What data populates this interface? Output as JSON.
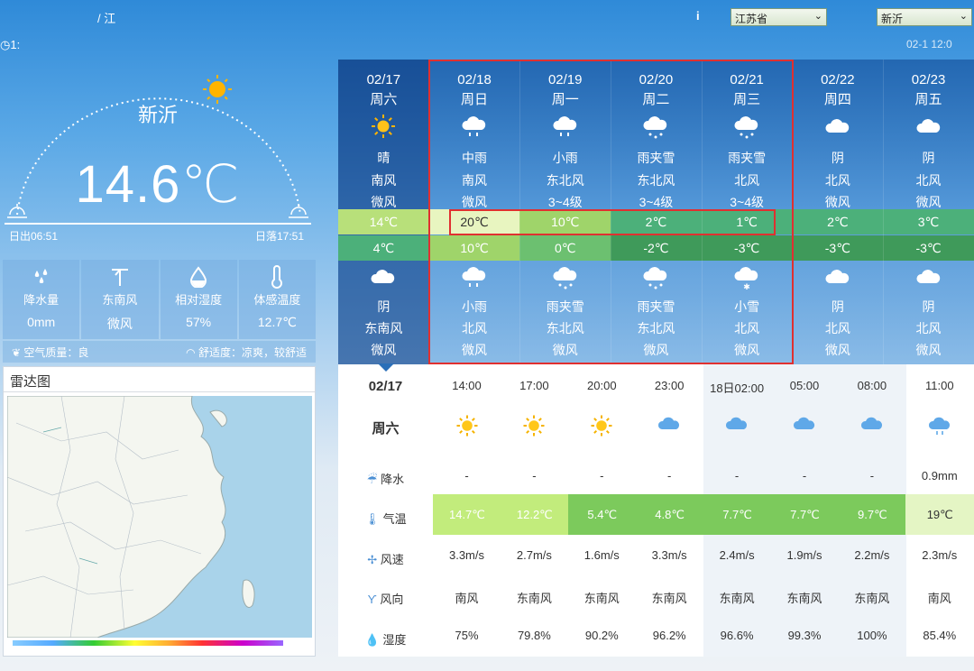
{
  "header": {
    "breadcrumb": "/ 江",
    "info_icon": "i",
    "province": "江苏省",
    "city": "新沂",
    "pub_time": "1:",
    "pub_time_right": "02-1 12:0"
  },
  "current": {
    "city": "新沂",
    "temperature": "14.6℃",
    "sunrise": "日出06:51",
    "sunset": "日落17:51"
  },
  "stats": [
    {
      "icon": "rain-drops-icon",
      "label": "降水量",
      "value": "0mm"
    },
    {
      "icon": "wind-direction-icon",
      "label": "东南风",
      "value": "微风"
    },
    {
      "icon": "humidity-drop-icon",
      "label": "相对湿度",
      "value": "57%"
    },
    {
      "icon": "thermometer-icon",
      "label": "体感温度",
      "value": "12.7℃"
    }
  ],
  "air": {
    "quality": "空气质量：良",
    "comfort": "舒适度：凉爽，较舒适"
  },
  "radar": {
    "title": "雷达图"
  },
  "forecast": [
    {
      "date": "02/17",
      "week": "周六",
      "day_icon": "sun-icon",
      "day_weather": "晴",
      "day_wind_dir": "南风",
      "day_wind_lvl": "微风",
      "hi": "14℃",
      "lo": "4℃",
      "night_icon": "cloud-icon",
      "night_weather": "阴",
      "night_wind_dir": "东南风",
      "night_wind_lvl": "微风"
    },
    {
      "date": "02/18",
      "week": "周日",
      "day_icon": "rain-icon",
      "day_weather": "中雨",
      "day_wind_dir": "南风",
      "day_wind_lvl": "微风",
      "hi": "20℃",
      "lo": "10℃",
      "night_icon": "rain-icon",
      "night_weather": "小雨",
      "night_wind_dir": "北风",
      "night_wind_lvl": "微风"
    },
    {
      "date": "02/19",
      "week": "周一",
      "day_icon": "rain-icon",
      "day_weather": "小雨",
      "day_wind_dir": "东北风",
      "day_wind_lvl": "3~4级",
      "hi": "10℃",
      "lo": "0℃",
      "night_icon": "sleet-icon",
      "night_weather": "雨夹雪",
      "night_wind_dir": "东北风",
      "night_wind_lvl": "微风"
    },
    {
      "date": "02/20",
      "week": "周二",
      "day_icon": "sleet-icon",
      "day_weather": "雨夹雪",
      "day_wind_dir": "东北风",
      "day_wind_lvl": "3~4级",
      "hi": "2℃",
      "lo": "-2℃",
      "night_icon": "sleet-icon",
      "night_weather": "雨夹雪",
      "night_wind_dir": "东北风",
      "night_wind_lvl": "微风"
    },
    {
      "date": "02/21",
      "week": "周三",
      "day_icon": "sleet-icon",
      "day_weather": "雨夹雪",
      "day_wind_dir": "北风",
      "day_wind_lvl": "3~4级",
      "hi": "1℃",
      "lo": "-3℃",
      "night_icon": "snow-icon",
      "night_weather": "小雪",
      "night_wind_dir": "北风",
      "night_wind_lvl": "微风"
    },
    {
      "date": "02/22",
      "week": "周四",
      "day_icon": "cloud-icon",
      "day_weather": "阴",
      "day_wind_dir": "北风",
      "day_wind_lvl": "微风",
      "hi": "2℃",
      "lo": "-3℃",
      "night_icon": "cloud-icon",
      "night_weather": "阴",
      "night_wind_dir": "北风",
      "night_wind_lvl": "微风"
    },
    {
      "date": "02/23",
      "week": "周五",
      "day_icon": "cloud-icon",
      "day_weather": "阴",
      "day_wind_dir": "北风",
      "day_wind_lvl": "微风",
      "hi": "3℃",
      "lo": "-3℃",
      "night_icon": "cloud-icon",
      "night_weather": "阴",
      "night_wind_dir": "北风",
      "night_wind_lvl": "微风"
    }
  ],
  "hourly": {
    "date": "02/17",
    "week": "周六",
    "row_labels": {
      "precip": "降水",
      "temp": "气温",
      "wind_speed": "风速",
      "wind_dir": "风向",
      "humidity": "湿度"
    },
    "times": [
      "14:00",
      "17:00",
      "20:00",
      "23:00",
      "18日02:00",
      "05:00",
      "08:00",
      "11:00"
    ],
    "icons": [
      "sun-icon",
      "sun-icon",
      "sun-icon",
      "cloud-icon",
      "cloud-icon",
      "cloud-icon",
      "cloud-icon",
      "rain-icon"
    ],
    "precip": [
      "-",
      "-",
      "-",
      "-",
      "-",
      "-",
      "-",
      "0.9mm"
    ],
    "temp": [
      "14.7℃",
      "12.2℃",
      "5.4℃",
      "4.8℃",
      "7.7℃",
      "7.7℃",
      "9.7℃",
      "19℃"
    ],
    "wind_speed": [
      "3.3m/s",
      "2.7m/s",
      "1.6m/s",
      "3.3m/s",
      "2.4m/s",
      "1.9m/s",
      "2.2m/s",
      "2.3m/s"
    ],
    "wind_dir": [
      "南风",
      "东南风",
      "东南风",
      "东南风",
      "东南风",
      "东南风",
      "东南风",
      "南风"
    ],
    "humidity": [
      "75%",
      "79.8%",
      "90.2%",
      "96.2%",
      "96.6%",
      "99.3%",
      "100%",
      "85.4%"
    ]
  },
  "colors": {
    "hi_temp": [
      "#b8e07a",
      "#e8f5c0",
      "#9fd46a",
      "#4cb07a",
      "#4cb07a",
      "#4cb07a",
      "#4cb07a"
    ],
    "lo_temp": [
      "#4cb07a",
      "#9fd46a",
      "#6cc070",
      "#3f9a5a",
      "#3f9a5a",
      "#3f9a5a",
      "#3f9a5a"
    ],
    "hourly_temp": [
      "#c2ec7c",
      "#c2ec7c",
      "#7cca5c",
      "#7cca5c",
      "#7cca5c",
      "#7cca5c",
      "#7cca5c",
      "#e4f5c4"
    ]
  }
}
